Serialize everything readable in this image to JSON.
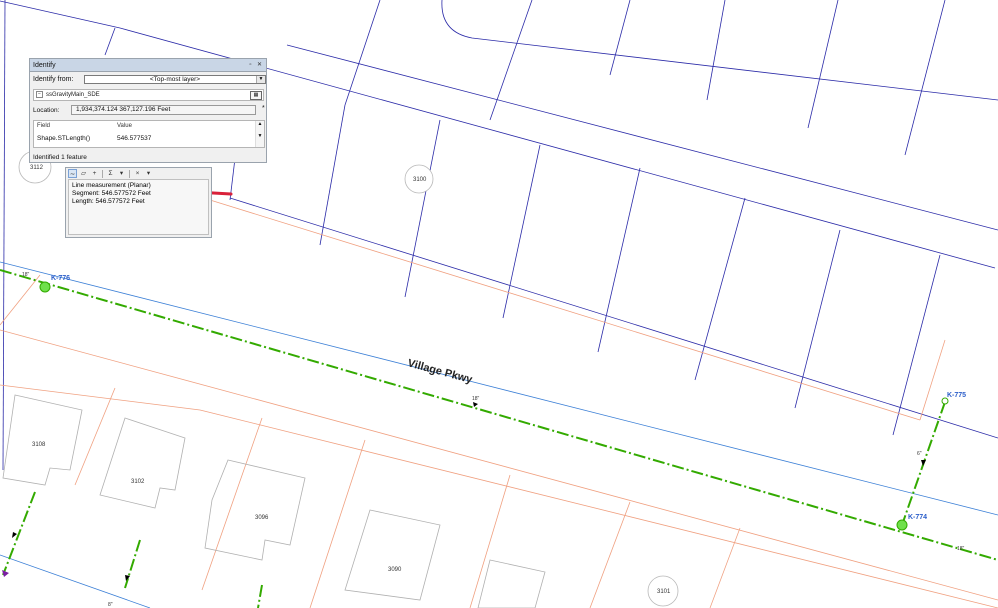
{
  "identify": {
    "title": "Identify",
    "from_label": "Identify from:",
    "from_value": "<Top-most layer>",
    "tree_item": "ssGravityMain_SDE",
    "location_label": "Location:",
    "location_value": "1,934,374.124  367,127.196 Feet",
    "field_header": "Field",
    "value_header": "Value",
    "field_name": "Shape.STLength()",
    "field_value": "546.577537",
    "status": "Identified 1 feature"
  },
  "measure": {
    "line1": "Line measurement (Planar)",
    "line2": "Segment: 546.577572 Feet",
    "line3": "Length: 546.577572 Feet"
  },
  "map": {
    "street_name": "Village Pkwy",
    "manholes": [
      "K-776",
      "K-775",
      "K-774"
    ],
    "pipe_labels": [
      "18\"",
      "18\"",
      "18\"",
      "6\"",
      "8\""
    ],
    "parcels": [
      "3112",
      "3100",
      "3108",
      "3102",
      "3096",
      "3090",
      "3101"
    ]
  },
  "colors": {
    "parcel_line": "#2b2ba8",
    "lot_line": "#f0a080",
    "sewer_main": "#33aa00",
    "street_centerline": "#3b7fd6",
    "arrow": "#d9213a"
  }
}
